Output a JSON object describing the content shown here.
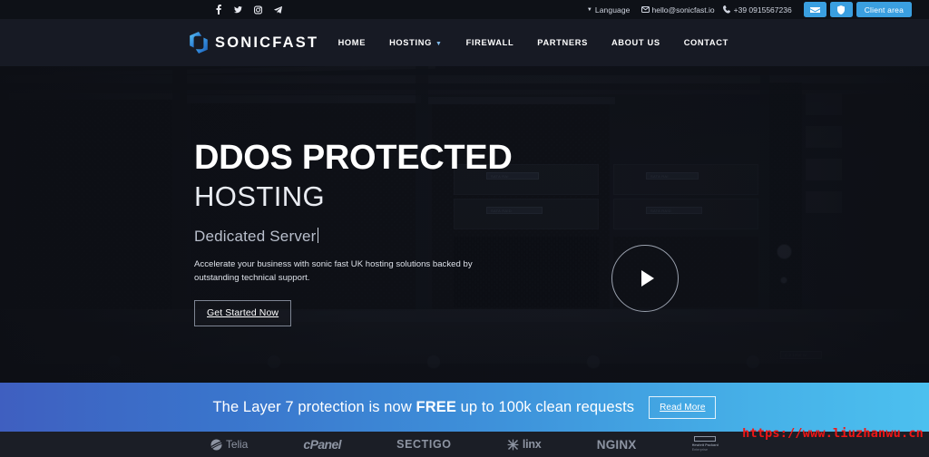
{
  "topbar": {
    "social": [
      {
        "name": "facebook-icon",
        "label": "f"
      },
      {
        "name": "twitter-icon",
        "label": "t"
      },
      {
        "name": "instagram-icon",
        "label": "ig"
      },
      {
        "name": "telegram-icon",
        "label": "tg"
      }
    ],
    "language_label": "Language",
    "email": "hello@sonicfast.io",
    "phone": "+39 0915567236",
    "buttons": [
      {
        "name": "mail-button",
        "icon": "mail-icon"
      },
      {
        "name": "support-button",
        "icon": "shield-icon"
      }
    ],
    "client_area_label": "Client area"
  },
  "nav": {
    "logo_text": "SONICFAST",
    "items": [
      {
        "label": "HOME",
        "has_dropdown": false
      },
      {
        "label": "HOSTING",
        "has_dropdown": true
      },
      {
        "label": "FIREWALL",
        "has_dropdown": false
      },
      {
        "label": "PARTNERS",
        "has_dropdown": false
      },
      {
        "label": "ABOUT US",
        "has_dropdown": false
      },
      {
        "label": "CONTACT",
        "has_dropdown": false
      }
    ]
  },
  "hero": {
    "heading_bold": "DDOS PROTECTED",
    "heading_light": "HOSTING",
    "typed_text": "Dedicated Server",
    "description": "Accelerate your business with sonic fast UK hosting solutions backed by outstanding technical support.",
    "cta_label": "Get Started Now",
    "play_button_name": "play-video-button"
  },
  "banner": {
    "text_before": "The Layer 7 protection is now ",
    "text_bold": "FREE",
    "text_after": " up to 100k clean requests",
    "read_more_label": "Read More"
  },
  "partners": {
    "logos": [
      {
        "name": "telia-logo",
        "label": "Telia"
      },
      {
        "name": "cpanel-logo",
        "label": "cPanel"
      },
      {
        "name": "sectigo-logo",
        "label": "SECTIGO"
      },
      {
        "name": "linx-logo",
        "label": "linx"
      },
      {
        "name": "nginx-logo",
        "label": "NGINX"
      },
      {
        "name": "hpe-logo",
        "label": "Hewlett Packard",
        "sublabel": "Enterprise"
      }
    ]
  },
  "watermark": {
    "text": "https://www.liuzhanwu.cn"
  },
  "colors": {
    "accent_blue": "#3a9fe0",
    "topbar_bg": "#0e1117",
    "navbar_bg": "#171a24",
    "banner_from": "#3f5fc0",
    "banner_to": "#4cc0ef",
    "watermark_red": "#f01616"
  }
}
